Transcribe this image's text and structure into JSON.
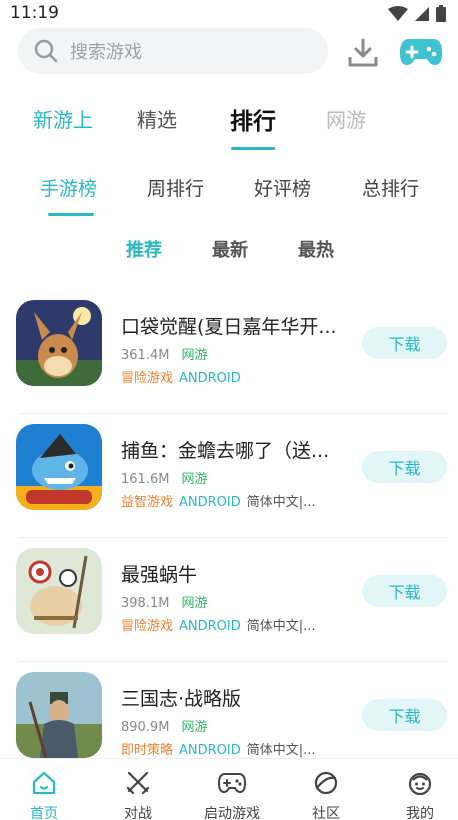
{
  "status_bar": {
    "time": "11:19"
  },
  "search": {
    "placeholder": "搜索游戏"
  },
  "main_tabs": [
    "新游上",
    "精选",
    "排行",
    "网游"
  ],
  "sub_tabs": [
    "手游榜",
    "周排行",
    "好评榜",
    "总排行"
  ],
  "filters": [
    "推荐",
    "最新",
    "最热"
  ],
  "games": [
    {
      "title": "口袋觉醒(夏日嘉年华开...",
      "size": "361.4M",
      "online": "网游",
      "genre": "冒险游戏",
      "platform": "ANDROID",
      "lang": "",
      "button": "下载"
    },
    {
      "title": "捕鱼：金蟾去哪了（送...",
      "size": "161.6M",
      "online": "网游",
      "genre": "益智游戏",
      "platform": "ANDROID",
      "lang": "简体中文|...",
      "button": "下载"
    },
    {
      "title": "最强蜗牛",
      "size": "398.1M",
      "online": "网游",
      "genre": "冒险游戏",
      "platform": "ANDROID",
      "lang": "简体中文|...",
      "button": "下载"
    },
    {
      "title": "三国志·战略版",
      "size": "890.9M",
      "online": "网游",
      "genre": "即时策略",
      "platform": "ANDROID",
      "lang": "简体中文|...",
      "button": "下载"
    }
  ],
  "bottom_nav": [
    "首页",
    "对战",
    "启动游戏",
    "社区",
    "我的"
  ],
  "colors": {
    "accent": "#2bb7c4",
    "genre": "#f08030",
    "online": "#32b563",
    "button_bg": "#e2f6f7"
  }
}
